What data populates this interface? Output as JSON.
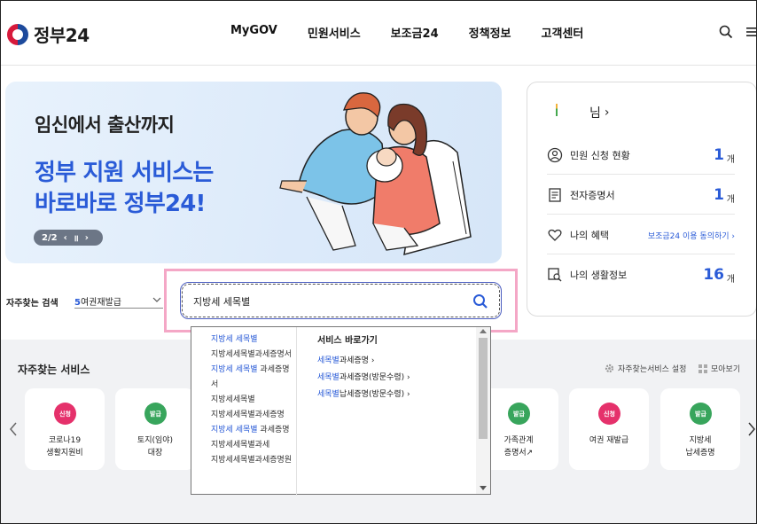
{
  "header": {
    "logo_text": "정부24",
    "nav": [
      "MyGOV",
      "민원서비스",
      "보조금24",
      "정책정보",
      "고객센터"
    ]
  },
  "hero": {
    "subtitle": "임신에서 출산까지",
    "title_line1": "정부 지원 서비스는",
    "title_line2": "바로바로 정부24!",
    "pager": "2/2",
    "prev": "‹",
    "pause": "॥",
    "next": "›"
  },
  "user_panel": {
    "name_suffix": "님",
    "arrow": "›",
    "rows": [
      {
        "label": "민원 신청 현황",
        "count": "1",
        "unit": "개"
      },
      {
        "label": "전자증명서",
        "count": "1",
        "unit": "개"
      },
      {
        "label": "나의 혜택",
        "link": "보조금24 이용 동의하기 ›"
      },
      {
        "label": "나의 생활정보",
        "count": "16",
        "unit": "개"
      }
    ]
  },
  "frequent_search": {
    "label": "자주찾는 검색",
    "rank": "5",
    "value": "여권재발급"
  },
  "search": {
    "value": "지방세 세목별",
    "placeholder": ""
  },
  "autocomplete": {
    "items": [
      {
        "hl": "지방세 세목별",
        "rest": ""
      },
      {
        "hl": "",
        "rest": "지방세세목별과세증명서"
      },
      {
        "hl": "지방세 세목별",
        "rest": " 과세증명서"
      },
      {
        "hl": "",
        "rest": "지방세세목별"
      },
      {
        "hl": "",
        "rest": "지방세세목별과세증명"
      },
      {
        "hl": "지방세 세목별",
        "rest": " 과세증명"
      },
      {
        "hl": "",
        "rest": "지방세세목별과세"
      },
      {
        "hl": "",
        "rest": "지방세세목별과세증명원"
      }
    ],
    "shortcut_title": "서비스 바로가기",
    "links": [
      {
        "hl": "세목별",
        "rest": "과세증명 ›"
      },
      {
        "hl": "세목별",
        "rest": "과세증명(방문수령) ›"
      },
      {
        "hl": "세목별",
        "rest": "납세증명(방문수령) ›"
      }
    ]
  },
  "services": {
    "title": "자주찾는 서비스",
    "settings_label": "자주찾는서비스 설정",
    "all_label": "모아보기",
    "cards": [
      {
        "badge": "신청",
        "badge_color": "red",
        "label_line1": "코로나19",
        "label_line2": "생활지원비"
      },
      {
        "badge": "발급",
        "badge_color": "green",
        "label_line1": "토지(임야)",
        "label_line2": "대장"
      },
      {
        "badge": "발급",
        "badge_color": "green",
        "label_line1": "가족관계",
        "label_line2": "증명서↗"
      },
      {
        "badge": "신청",
        "badge_color": "red",
        "label_line1": "여권 재발급",
        "label_line2": ""
      },
      {
        "badge": "발급",
        "badge_color": "green",
        "label_line1": "지방세",
        "label_line2": "납세증명"
      }
    ]
  },
  "colors": {
    "accent_blue": "#2a5bd7",
    "badge_red": "#e5316b",
    "badge_green": "#38a55c",
    "highlight_pink": "#f4a7c6"
  }
}
